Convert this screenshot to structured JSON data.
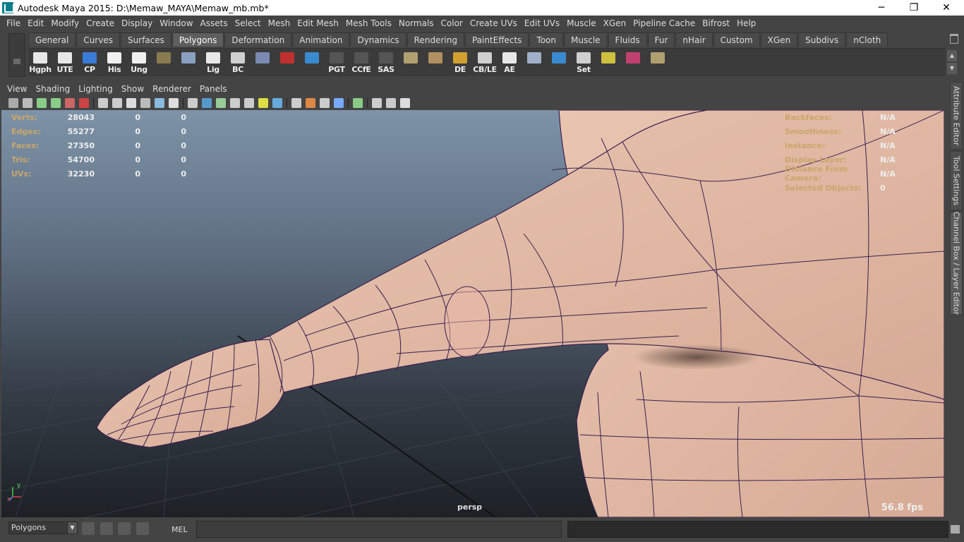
{
  "window": {
    "title": "Autodesk Maya 2015: D:\\Memaw_MAYA\\Memaw_mb.mb*",
    "minimize": "─",
    "maximize": "❐",
    "close": "✕"
  },
  "menubar": [
    "File",
    "Edit",
    "Modify",
    "Create",
    "Display",
    "Window",
    "Assets",
    "Select",
    "Mesh",
    "Edit Mesh",
    "Mesh Tools",
    "Normals",
    "Color",
    "Create UVs",
    "Edit UVs",
    "Muscle",
    "XGen",
    "Pipeline Cache",
    "Bifrost",
    "Help"
  ],
  "shelf_tabs": [
    "General",
    "Curves",
    "Surfaces",
    "Polygons",
    "Deformation",
    "Animation",
    "Dynamics",
    "Rendering",
    "PaintEffects",
    "Toon",
    "Muscle",
    "Fluids",
    "Fur",
    "nHair",
    "Custom",
    "XGen",
    "Subdivs",
    "nCloth"
  ],
  "active_shelf_tab": "Polygons",
  "shelf_buttons": [
    {
      "label": "Hgph",
      "color": "#e8e8e8",
      "icon": "document-icon"
    },
    {
      "label": "UTE",
      "color": "#e8e8e8",
      "icon": "document-icon"
    },
    {
      "label": "CP",
      "color": "#3a7bd5",
      "icon": "axis-icon"
    },
    {
      "label": "His",
      "color": "#f0f0f0",
      "icon": "pen-doc-icon"
    },
    {
      "label": "Ung",
      "color": "#f0f0f0",
      "icon": "pen-doc-icon"
    },
    {
      "label": "",
      "color": "#8a7a50",
      "icon": "stack-icon"
    },
    {
      "label": "",
      "color": "#8aa0c0",
      "icon": "globe-icon"
    },
    {
      "label": "Lig",
      "color": "#e8e8e8",
      "icon": "document-icon"
    },
    {
      "label": "BC",
      "color": "#cfcfcf",
      "icon": "eye-icon"
    },
    {
      "label": "",
      "color": "#7a8ab0",
      "icon": "cube-icon"
    },
    {
      "label": "",
      "color": "#c03030",
      "icon": "film-icon"
    },
    {
      "label": "",
      "color": "#3a8ad0",
      "icon": "curve-icon"
    },
    {
      "label": "PGT",
      "color": "#555555",
      "icon": "blank-icon"
    },
    {
      "label": "CCfE",
      "color": "#555555",
      "icon": "blank-icon"
    },
    {
      "label": "SAS",
      "color": "#555555",
      "icon": "blank-icon"
    },
    {
      "label": "",
      "color": "#b0a070",
      "icon": "plane-icon"
    },
    {
      "label": "",
      "color": "#b09060",
      "icon": "plane-icon"
    },
    {
      "label": "DE",
      "color": "#d0a030",
      "icon": "sun-icon"
    },
    {
      "label": "CB/LE",
      "color": "#cfcfcf",
      "icon": "eye-icon"
    },
    {
      "label": "AE",
      "color": "#e8e8e8",
      "icon": "document-icon"
    },
    {
      "label": "",
      "color": "#a0b0c8",
      "icon": "bone-icon"
    },
    {
      "label": "",
      "color": "#3a8ad0",
      "icon": "wave-icon"
    },
    {
      "label": "Set",
      "color": "#cfcfcf",
      "icon": "key-icon"
    },
    {
      "label": "",
      "color": "#d0c040",
      "icon": "target-icon"
    },
    {
      "label": "",
      "color": "#c04070",
      "icon": "gizmo-icon"
    },
    {
      "label": "",
      "color": "#b0a070",
      "icon": "plane-icon"
    }
  ],
  "viewport_menu": [
    "View",
    "Shading",
    "Lighting",
    "Show",
    "Renderer",
    "Panels"
  ],
  "hud_left": [
    {
      "label": "Verts:",
      "v1": "28043",
      "v2": "0",
      "v3": "0"
    },
    {
      "label": "Edges:",
      "v1": "55277",
      "v2": "0",
      "v3": "0"
    },
    {
      "label": "Faces:",
      "v1": "27350",
      "v2": "0",
      "v3": "0"
    },
    {
      "label": "Tris:",
      "v1": "54700",
      "v2": "0",
      "v3": "0"
    },
    {
      "label": "UVs:",
      "v1": "32230",
      "v2": "0",
      "v3": "0"
    }
  ],
  "hud_right": [
    {
      "label": "Backfaces:",
      "value": "N/A"
    },
    {
      "label": "Smoothness:",
      "value": "N/A"
    },
    {
      "label": "Instance:",
      "value": "N/A"
    },
    {
      "label": "Display Layer:",
      "value": "N/A"
    },
    {
      "label": "Distance From Camera:",
      "value": "N/A"
    },
    {
      "label": "Selected Objects:",
      "value": "0"
    }
  ],
  "camera_label": "persp",
  "fps": "56.8 fps",
  "axis": {
    "y": "y",
    "x": "x"
  },
  "side_tabs": [
    "Attribute Editor",
    "Tool Settings",
    "Channel Box / Layer Editor"
  ],
  "bottom": {
    "mode": "Polygons",
    "mel_label": "MEL",
    "command": "",
    "result": ""
  }
}
